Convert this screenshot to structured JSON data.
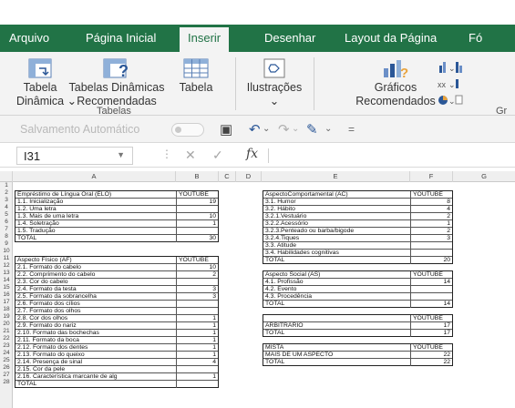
{
  "ribbon": {
    "tabs": [
      "Arquivo",
      "Página Inicial",
      "Inserir",
      "Desenhar",
      "Layout da Página",
      "Fó"
    ],
    "active_tab": "Inserir",
    "buttons": {
      "tabela_dinamica_1": "Tabela",
      "tabela_dinamica_2": "Dinâmica ⌄",
      "tabelas_recomendadas_1": "Tabelas Dinâmicas",
      "tabelas_recomendadas_2": "Recomendadas",
      "tabela": "Tabela",
      "ilustracoes": "Ilustrações",
      "ilustracoes_dd": "⌄",
      "graficos_1": "Gráficos",
      "graficos_2": "Recomendados",
      "gr_cut": "Gr"
    },
    "groups": {
      "tabelas": "Tabelas"
    }
  },
  "qat": {
    "autosave": "Salvamento Automático"
  },
  "formula_bar": {
    "name_box": "I31",
    "fx": "fx",
    "value": ""
  },
  "columns": [
    "A",
    "B",
    "C",
    "D",
    "E",
    "F",
    "G"
  ],
  "rows": [
    "1",
    "2",
    "3",
    "4",
    "5",
    "6",
    "7",
    "8",
    "9",
    "10",
    "11",
    "12",
    "13",
    "14",
    "15",
    "16",
    "17",
    "18",
    "19",
    "20",
    "21",
    "22",
    "23",
    "24",
    "25",
    "26",
    "27",
    "28"
  ],
  "sheet": {
    "elo": {
      "header": [
        "Empréstimo de Língua Oral (ELO)",
        "YOUTUBE"
      ],
      "rows": [
        [
          "1.1. Inicialização",
          "19"
        ],
        [
          "1.2. Uma letra",
          ""
        ],
        [
          "1.3. Mais de uma letra",
          "10"
        ],
        [
          "1.4. Soletração",
          "1"
        ],
        [
          "1.5. Tradução",
          ""
        ],
        [
          "TOTAL",
          "30"
        ]
      ]
    },
    "af": {
      "header": [
        "Aspecto Físico (AF)",
        "YOUTUBE"
      ],
      "rows": [
        [
          "2.1. Formato do cabelo",
          "10"
        ],
        [
          "2.2. Comprimento do cabelo",
          "2"
        ],
        [
          "2.3. Cor do cabelo",
          ""
        ],
        [
          "2.4. Formato da testa",
          "3"
        ],
        [
          "2.5. Formato da sobrancelha",
          "3"
        ],
        [
          "2.6. Formato dos cílios",
          ""
        ],
        [
          "2.7. Formato dos olhos",
          ""
        ],
        [
          "2.8. Cor dos olhos",
          "1"
        ],
        [
          "2.9. Formato do nariz",
          "1"
        ],
        [
          "2.10. Formato das bochechas",
          "1"
        ],
        [
          "2.11. Formato da boca",
          "1"
        ],
        [
          "2.12. Formato dos dentes",
          "1"
        ],
        [
          "2.13. Formato do queixo",
          "1"
        ],
        [
          "2.14. Presença de sinal",
          "4"
        ],
        [
          "2.15. Cor da pele",
          ""
        ],
        [
          "2.16. Característica marcante de alg",
          "1"
        ],
        [
          "TOTAL",
          ""
        ]
      ]
    },
    "ac": {
      "header": [
        "AspectoComportamental (AC)",
        "YOUTUBE"
      ],
      "rows": [
        [
          "3.1. Humor",
          "8"
        ],
        [
          "3.2. Hábito",
          "4"
        ],
        [
          "3.2.1.Vestuário",
          "2"
        ],
        [
          "3.2.2.Acessório",
          "1"
        ],
        [
          "3.2.3.Penteado ou barba/bigode",
          "2"
        ],
        [
          "3.2.4.Tiques",
          "3"
        ],
        [
          "3.3. Atitude",
          ""
        ],
        [
          "3.4. Habilidades cognitivas",
          ""
        ],
        [
          "TOTAL",
          "20"
        ]
      ]
    },
    "as": {
      "header": [
        "Aspecto Social (AS)",
        "YOUTUBE"
      ],
      "rows": [
        [
          "4.1. Profissão",
          "14"
        ],
        [
          "4.2. Evento",
          ""
        ],
        [
          "4.3. Procedência",
          ""
        ],
        [
          "TOTAL",
          "14"
        ]
      ]
    },
    "arb": {
      "header": [
        "",
        "YOUTUBE"
      ],
      "rows": [
        [
          "ARBITRÁRIO",
          "17"
        ],
        [
          "TOTAL",
          "17"
        ]
      ]
    },
    "mista": {
      "header": [
        "MISTA",
        "YOUTUBE"
      ],
      "rows": [
        [
          "MAIS DE UM ASPECTO",
          "22"
        ],
        [
          "TOTAL",
          "22"
        ]
      ]
    }
  }
}
